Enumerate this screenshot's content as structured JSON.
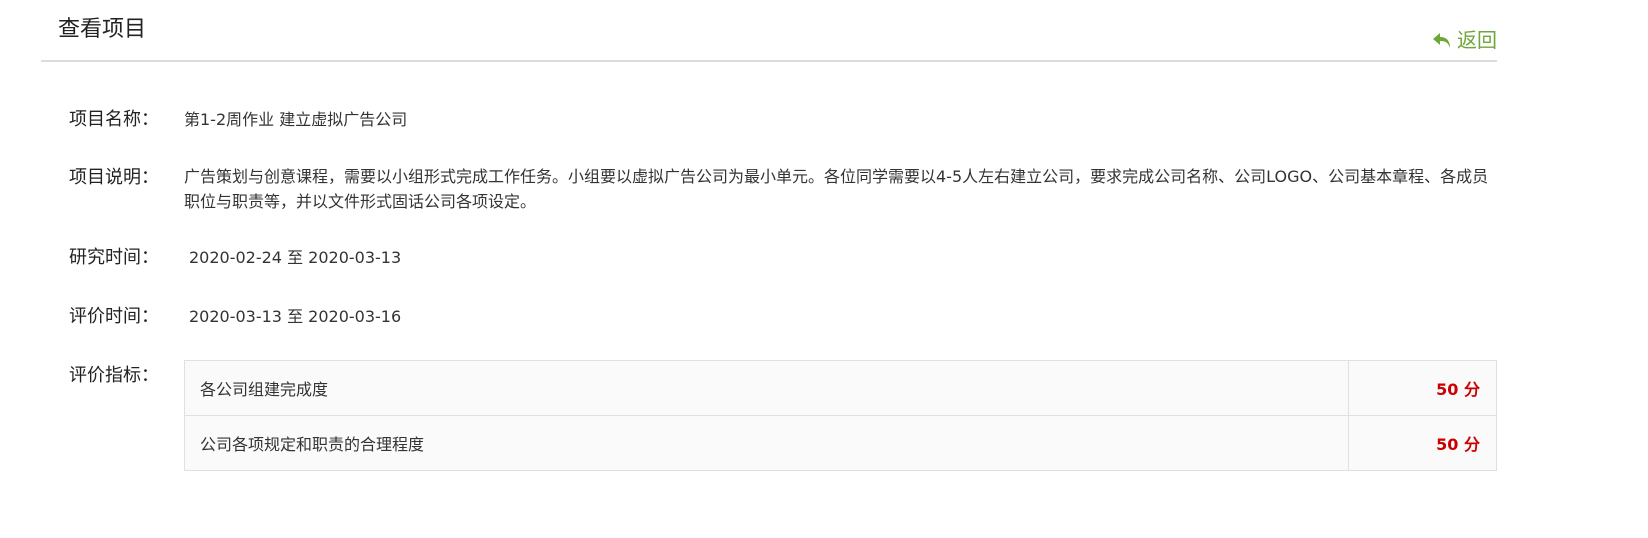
{
  "header": {
    "title": "查看项目",
    "back_label": "返回",
    "back_icon": "reply-arrow-icon",
    "accent_color": "#6fa637"
  },
  "project": {
    "name_label": "项目名称：",
    "name_value": "第1-2周作业 建立虚拟广告公司",
    "desc_label": "项目说明：",
    "desc_value": "广告策划与创意课程，需要以小组形式完成工作任务。小组要以虚拟广告公司为最小单元。各位同学需要以4-5人左右建立公司，要求完成公司名称、公司LOGO、公司基本章程、各成员职位与职责等，并以文件形式固话公司各项设定。",
    "research_label": "研究时间：",
    "research_value": "2020-02-24 至 2020-03-13",
    "eval_label": "评价时间：",
    "eval_value": "2020-03-13 至 2020-03-16",
    "criteria_label": "评价指标："
  },
  "criteria": [
    {
      "name": "各公司组建完成度",
      "score": "50 分"
    },
    {
      "name": "公司各项规定和职责的合理程度",
      "score": "50 分"
    }
  ],
  "colors": {
    "score": "#cc0000",
    "divider": "#dcdcdc"
  }
}
